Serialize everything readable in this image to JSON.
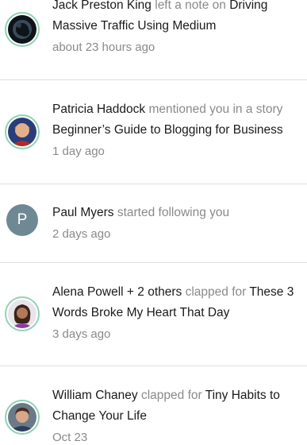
{
  "notifications": [
    {
      "actor": "Jack Preston King",
      "action": " left a note on ",
      "target": "Driving Massive Traffic Using Medium",
      "time": "about 23 hours ago"
    },
    {
      "actor": "Patricia Haddock",
      "action": " mentioned you in a story",
      "target": "Beginner’s Guide to Blogging for Business",
      "time": "1 day ago"
    },
    {
      "avatar_initial": "P",
      "actor": "Paul Myers",
      "action": " started following you",
      "time": "2 days ago"
    },
    {
      "actor": "Alena Powell + 2 others",
      "action": " clapped for ",
      "target": "These 3 Words Broke My Heart That Day",
      "time": "3 days ago"
    },
    {
      "actor": "William Chaney",
      "action": " clapped for ",
      "target": "Tiny Habits to Change Your Life",
      "time": "Oct 23"
    }
  ],
  "colors": {
    "ring": "#8fd3b4",
    "muted_text": "#8a8a8a",
    "primary_text": "#1a1a1a",
    "avatar_plain_bg": "#6e8894"
  }
}
